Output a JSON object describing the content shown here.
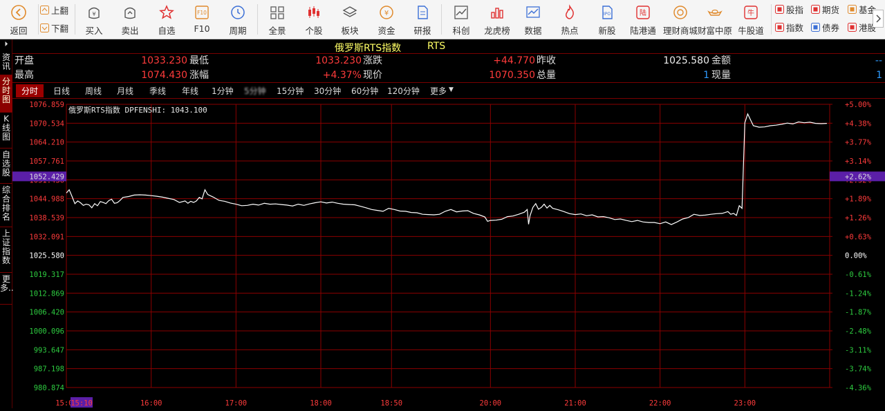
{
  "toolbar": {
    "buttons": [
      {
        "label": "返回",
        "icon": "back-arrow-icon"
      },
      {
        "label": "买入",
        "icon": "buy-icon"
      },
      {
        "label": "卖出",
        "icon": "sell-icon"
      },
      {
        "label": "自选",
        "icon": "star-icon"
      },
      {
        "label": "F10",
        "icon": "f10-icon"
      },
      {
        "label": "周期",
        "icon": "clock-icon"
      },
      {
        "label": "全景",
        "icon": "grid-icon"
      },
      {
        "label": "个股",
        "icon": "candlestick-icon"
      },
      {
        "label": "板块",
        "icon": "layers-icon"
      },
      {
        "label": "资金",
        "icon": "yen-coin-icon"
      },
      {
        "label": "研报",
        "icon": "report-icon"
      },
      {
        "label": "科创",
        "icon": "chart-line-icon"
      },
      {
        "label": "龙虎榜",
        "icon": "bar-chart-icon"
      },
      {
        "label": "数据",
        "icon": "trend-icon"
      },
      {
        "label": "热点",
        "icon": "flame-icon"
      },
      {
        "label": "新股",
        "icon": "ipo-icon"
      },
      {
        "label": "陆港通",
        "icon": "lu-icon"
      },
      {
        "label": "理财商城",
        "icon": "mall-icon"
      },
      {
        "label": "财富中原",
        "icon": "ingot-icon"
      },
      {
        "label": "牛股道",
        "icon": "niu-icon"
      }
    ],
    "page_up": "上翻",
    "page_down": "下翻",
    "quick_links": [
      {
        "label": "股指",
        "icon": "index-icon"
      },
      {
        "label": "期货",
        "icon": "futures-icon"
      },
      {
        "label": "基金",
        "icon": "fund-icon"
      },
      {
        "label": "指数",
        "icon": "index2-icon"
      },
      {
        "label": "债券",
        "icon": "bond-icon"
      },
      {
        "label": "港股",
        "icon": "hk-icon"
      }
    ]
  },
  "sidebar": {
    "items": [
      "资讯",
      "分时图",
      "K线图",
      "自选股",
      "综合排名",
      "上证指数",
      "更多.."
    ]
  },
  "title": {
    "name": "俄罗斯RTS指数",
    "code": "RTS"
  },
  "quotes": {
    "open_label": "开盘",
    "open": "1033.230",
    "high_label": "最高",
    "high": "1074.430",
    "low_label": "最低",
    "low": "1033.230",
    "amp_label": "涨幅",
    "amp": "+4.37%",
    "chg_label": "涨跌",
    "chg": "+44.770",
    "price_label": "现价",
    "price": "1070.350",
    "prev_label": "昨收",
    "prev": "1025.580",
    "vol_label": "总量",
    "vol": "1",
    "amt_label": "金额",
    "amt": "--",
    "cur_label": "现量",
    "cur": "1"
  },
  "periods": [
    "分时",
    "日线",
    "周线",
    "月线",
    "季线",
    "年线",
    "1分钟",
    "5分钟",
    "15分钟",
    "30分钟",
    "60分钟",
    "120分钟",
    "更多"
  ],
  "colors": {
    "up": "#ff3b3b",
    "down": "#2ecc40",
    "neutral": "#ffffff",
    "grid": "#8b0000",
    "highlight": "#5b1fa8"
  },
  "chart_data": {
    "type": "line",
    "legend": "俄罗斯RTS指数 DPFENSHI: 1043.100",
    "prev_close": 1025.58,
    "y_ticks": [
      {
        "price": "1076.859",
        "pct": "+5.00%",
        "dir": "up"
      },
      {
        "price": "1070.534",
        "pct": "+4.38%",
        "dir": "up"
      },
      {
        "price": "1064.210",
        "pct": "+3.77%",
        "dir": "up"
      },
      {
        "price": "1057.761",
        "pct": "+3.14%",
        "dir": "up"
      },
      {
        "price": "1051.436",
        "pct": "+2.52%",
        "dir": "up"
      },
      {
        "price": "1044.988",
        "pct": "+1.89%",
        "dir": "up"
      },
      {
        "price": "1038.539",
        "pct": "+1.26%",
        "dir": "up"
      },
      {
        "price": "1032.091",
        "pct": "+0.63%",
        "dir": "up"
      },
      {
        "price": "1025.580",
        "pct": "0.00%",
        "dir": "zero"
      },
      {
        "price": "1019.317",
        "pct": "-0.61%",
        "dir": "down"
      },
      {
        "price": "1012.869",
        "pct": "-1.24%",
        "dir": "down"
      },
      {
        "price": "1006.420",
        "pct": "-1.87%",
        "dir": "down"
      },
      {
        "price": "1000.096",
        "pct": "-2.48%",
        "dir": "down"
      },
      {
        "price": "993.647",
        "pct": "-3.11%",
        "dir": "down"
      },
      {
        "price": "987.198",
        "pct": "-3.74%",
        "dir": "down"
      },
      {
        "price": "980.874",
        "pct": "-4.36%",
        "dir": "down"
      }
    ],
    "highlight": {
      "price": "1052.429",
      "pct": "+2.62%",
      "time": "15:10"
    },
    "x_ticks": [
      "15:00",
      "16:00",
      "17:00",
      "18:00",
      "18:50",
      "20:00",
      "21:00",
      "22:00",
      "23:00"
    ],
    "x_label_offsets_min": [
      0,
      60,
      120,
      180,
      230,
      300,
      360,
      420,
      480
    ],
    "x_grid_offsets_min": [
      60,
      120,
      180,
      230,
      300,
      360,
      420,
      480
    ],
    "session_minutes": 540,
    "ylim": [
      980.874,
      1076.859
    ],
    "points": [
      [
        0,
        1046.8
      ],
      [
        2,
        1047.9
      ],
      [
        4,
        1045.6
      ],
      [
        6,
        1043.2
      ],
      [
        8,
        1044.1
      ],
      [
        10,
        1043.5
      ],
      [
        12,
        1042.6
      ],
      [
        14,
        1043.0
      ],
      [
        16,
        1042.8
      ],
      [
        18,
        1041.8
      ],
      [
        20,
        1043.2
      ],
      [
        22,
        1042.5
      ],
      [
        24,
        1043.9
      ],
      [
        26,
        1043.6
      ],
      [
        28,
        1043.2
      ],
      [
        30,
        1044.2
      ],
      [
        32,
        1044.7
      ],
      [
        34,
        1043.3
      ],
      [
        36,
        1043.5
      ],
      [
        38,
        1044.3
      ],
      [
        40,
        1045.3
      ],
      [
        44,
        1045.6
      ],
      [
        48,
        1046.1
      ],
      [
        52,
        1046.2
      ],
      [
        56,
        1046.1
      ],
      [
        60,
        1045.9
      ],
      [
        64,
        1045.7
      ],
      [
        68,
        1045.4
      ],
      [
        72,
        1045.0
      ],
      [
        76,
        1044.6
      ],
      [
        80,
        1043.6
      ],
      [
        84,
        1044.1
      ],
      [
        86,
        1043.3
      ],
      [
        88,
        1044.0
      ],
      [
        90,
        1043.6
      ],
      [
        92,
        1044.1
      ],
      [
        94,
        1045.3
      ],
      [
        96,
        1044.8
      ],
      [
        98,
        1047.9
      ],
      [
        100,
        1046.3
      ],
      [
        104,
        1045.4
      ],
      [
        108,
        1044.3
      ],
      [
        112,
        1044.0
      ],
      [
        116,
        1043.4
      ],
      [
        120,
        1043.0
      ],
      [
        124,
        1042.5
      ],
      [
        128,
        1042.6
      ],
      [
        132,
        1043.0
      ],
      [
        136,
        1042.7
      ],
      [
        140,
        1043.3
      ],
      [
        144,
        1043.0
      ],
      [
        148,
        1043.1
      ],
      [
        152,
        1042.9
      ],
      [
        156,
        1042.7
      ],
      [
        160,
        1042.4
      ],
      [
        164,
        1043.0
      ],
      [
        168,
        1042.6
      ],
      [
        172,
        1043.1
      ],
      [
        176,
        1043.5
      ],
      [
        180,
        1043.8
      ],
      [
        184,
        1043.4
      ],
      [
        188,
        1043.7
      ],
      [
        192,
        1043.3
      ],
      [
        196,
        1043.0
      ],
      [
        200,
        1042.9
      ],
      [
        204,
        1042.8
      ],
      [
        208,
        1042.3
      ],
      [
        212,
        1041.8
      ],
      [
        216,
        1041.2
      ],
      [
        220,
        1040.9
      ],
      [
        224,
        1040.6
      ],
      [
        228,
        1041.6
      ],
      [
        232,
        1041.2
      ],
      [
        236,
        1040.7
      ],
      [
        240,
        1040.6
      ],
      [
        244,
        1040.2
      ],
      [
        248,
        1040.1
      ],
      [
        252,
        1039.6
      ],
      [
        256,
        1039.5
      ],
      [
        260,
        1039.4
      ],
      [
        264,
        1039.6
      ],
      [
        268,
        1040.6
      ],
      [
        272,
        1041.2
      ],
      [
        276,
        1040.4
      ],
      [
        280,
        1040.7
      ],
      [
        284,
        1040.8
      ],
      [
        288,
        1039.9
      ],
      [
        292,
        1039.4
      ],
      [
        296,
        1038.7
      ],
      [
        298,
        1037.2
      ],
      [
        300,
        1037.5
      ],
      [
        304,
        1037.6
      ],
      [
        308,
        1037.9
      ],
      [
        312,
        1038.8
      ],
      [
        316,
        1039.0
      ],
      [
        320,
        1039.6
      ],
      [
        324,
        1040.3
      ],
      [
        326,
        1041.2
      ],
      [
        327,
        1036.2
      ],
      [
        328,
        1039.1
      ],
      [
        330,
        1041.9
      ],
      [
        332,
        1043.2
      ],
      [
        334,
        1041.3
      ],
      [
        336,
        1041.9
      ],
      [
        338,
        1043.0
      ],
      [
        340,
        1041.7
      ],
      [
        342,
        1042.6
      ],
      [
        344,
        1041.6
      ],
      [
        348,
        1041.1
      ],
      [
        352,
        1040.5
      ],
      [
        356,
        1039.8
      ],
      [
        360,
        1039.5
      ],
      [
        364,
        1039.7
      ],
      [
        368,
        1039.1
      ],
      [
        372,
        1039.4
      ],
      [
        376,
        1038.7
      ],
      [
        380,
        1038.8
      ],
      [
        384,
        1038.4
      ],
      [
        388,
        1037.8
      ],
      [
        392,
        1038.0
      ],
      [
        396,
        1037.5
      ],
      [
        400,
        1037.1
      ],
      [
        404,
        1037.5
      ],
      [
        408,
        1037.0
      ],
      [
        412,
        1036.8
      ],
      [
        416,
        1036.8
      ],
      [
        420,
        1036.4
      ],
      [
        424,
        1037.0
      ],
      [
        428,
        1036.1
      ],
      [
        432,
        1037.0
      ],
      [
        436,
        1038.0
      ],
      [
        440,
        1038.5
      ],
      [
        444,
        1039.6
      ],
      [
        448,
        1039.2
      ],
      [
        452,
        1039.3
      ],
      [
        456,
        1039.6
      ],
      [
        460,
        1039.8
      ],
      [
        464,
        1039.9
      ],
      [
        468,
        1040.5
      ],
      [
        470,
        1039.6
      ],
      [
        472,
        1039.9
      ],
      [
        474,
        1039.2
      ],
      [
        476,
        1042.5
      ],
      [
        478,
        1041.6
      ],
      [
        480,
        1070.6
      ],
      [
        482,
        1073.6
      ],
      [
        484,
        1071.6
      ],
      [
        486,
        1069.6
      ],
      [
        490,
        1069.1
      ],
      [
        494,
        1069.2
      ],
      [
        498,
        1069.6
      ],
      [
        502,
        1069.8
      ],
      [
        506,
        1070.1
      ],
      [
        510,
        1070.5
      ],
      [
        514,
        1070.2
      ],
      [
        518,
        1070.9
      ],
      [
        522,
        1070.6
      ],
      [
        526,
        1070.8
      ],
      [
        530,
        1070.4
      ],
      [
        534,
        1070.3
      ],
      [
        538,
        1070.4
      ]
    ]
  }
}
